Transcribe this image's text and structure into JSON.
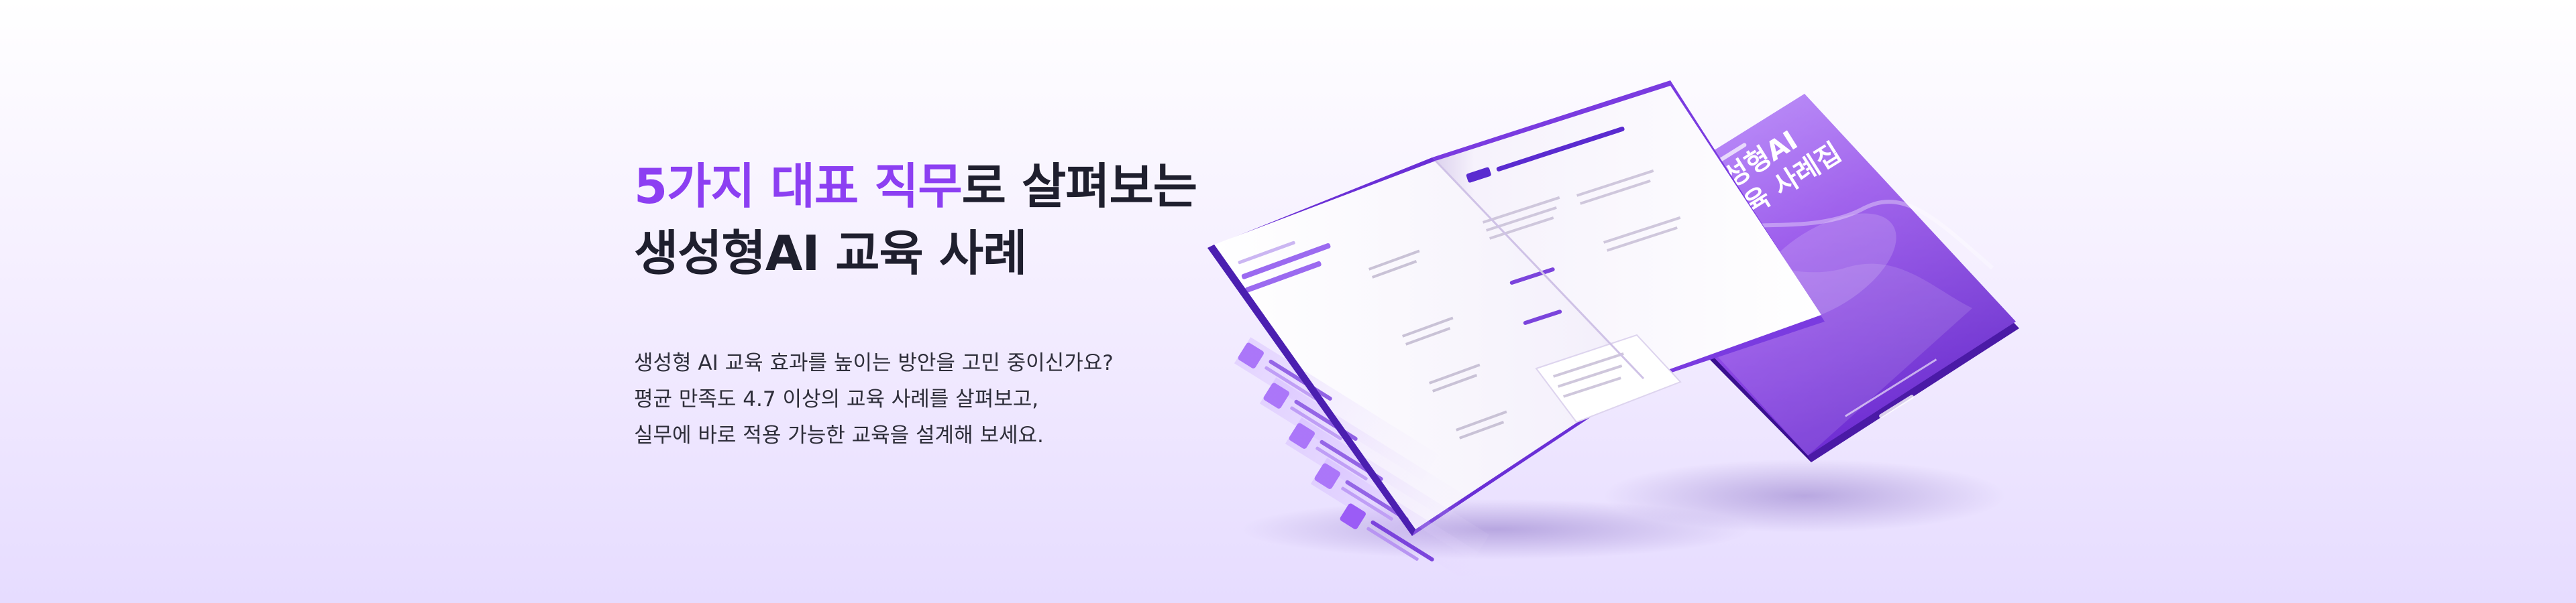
{
  "headline": {
    "line1_accent": "5가지 대표 직무",
    "line1_rest": "로 살펴보는",
    "line2": "생성형AI 교육 사례"
  },
  "description": {
    "line1": "생성형 AI 교육 효과를 높이는 방안을 고민 중이신가요?",
    "line2": "평균 만족도 4.7 이상의 교육 사례를 살펴보고,",
    "line3": "실무에 바로 적용 가능한 교육을 설계해 보세요."
  },
  "brochure": {
    "cover_title_line1": "생성형AI",
    "cover_title_line2": "교육 사례집"
  },
  "colors": {
    "accent": "#8c3ff2",
    "text_dark": "#1f1f2e",
    "cover_purple": "#8a3ee8"
  }
}
